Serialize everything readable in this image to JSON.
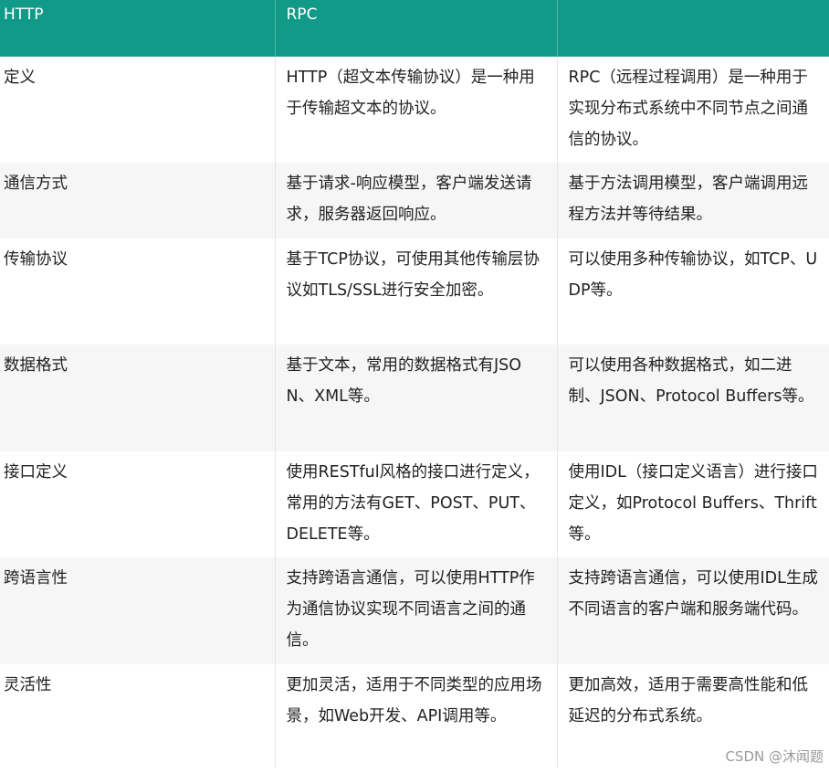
{
  "table": {
    "headers": [
      "HTTP",
      "RPC",
      ""
    ],
    "rows": [
      [
        "定义",
        "HTTP（超文本传输协议）是一种用于传输超文本的协议。",
        "RPC（远程过程调用）是一种用于实现分布式系统中不同节点之间通信的协议。"
      ],
      [
        "通信方式",
        "基于请求-响应模型，客户端发送请求，服务器返回响应。",
        "基于方法调用模型，客户端调用远程方法并等待结果。"
      ],
      [
        "传输协议",
        "基于TCP协议，可使用其他传输层协议如TLS/SSL进行安全加密。",
        "可以使用多种传输协议，如TCP、UDP等。"
      ],
      [
        "数据格式",
        "基于文本，常用的数据格式有JSON、XML等。",
        "可以使用各种数据格式，如二进制、JSON、Protocol Buffers等。"
      ],
      [
        "接口定义",
        "使用RESTful风格的接口进行定义，常用的方法有GET、POST、PUT、DELETE等。",
        "使用IDL（接口定义语言）进行接口定义，如Protocol Buffers、Thrift等。"
      ],
      [
        "跨语言性",
        "支持跨语言通信，可以使用HTTP作为通信协议实现不同语言之间的通信。",
        "支持跨语言通信，可以使用IDL生成不同语言的客户端和服务端代码。"
      ],
      [
        "灵活性",
        "更加灵活，适用于不同类型的应用场景，如Web开发、API调用等。",
        "更加高效，适用于需要高性能和低延迟的分布式系统。"
      ]
    ]
  },
  "watermark": "CSDN @沐闻题",
  "colors": {
    "header_bg": "#129a88",
    "header_text": "#ffffff",
    "stripe_bg": "#f6f6f6"
  }
}
